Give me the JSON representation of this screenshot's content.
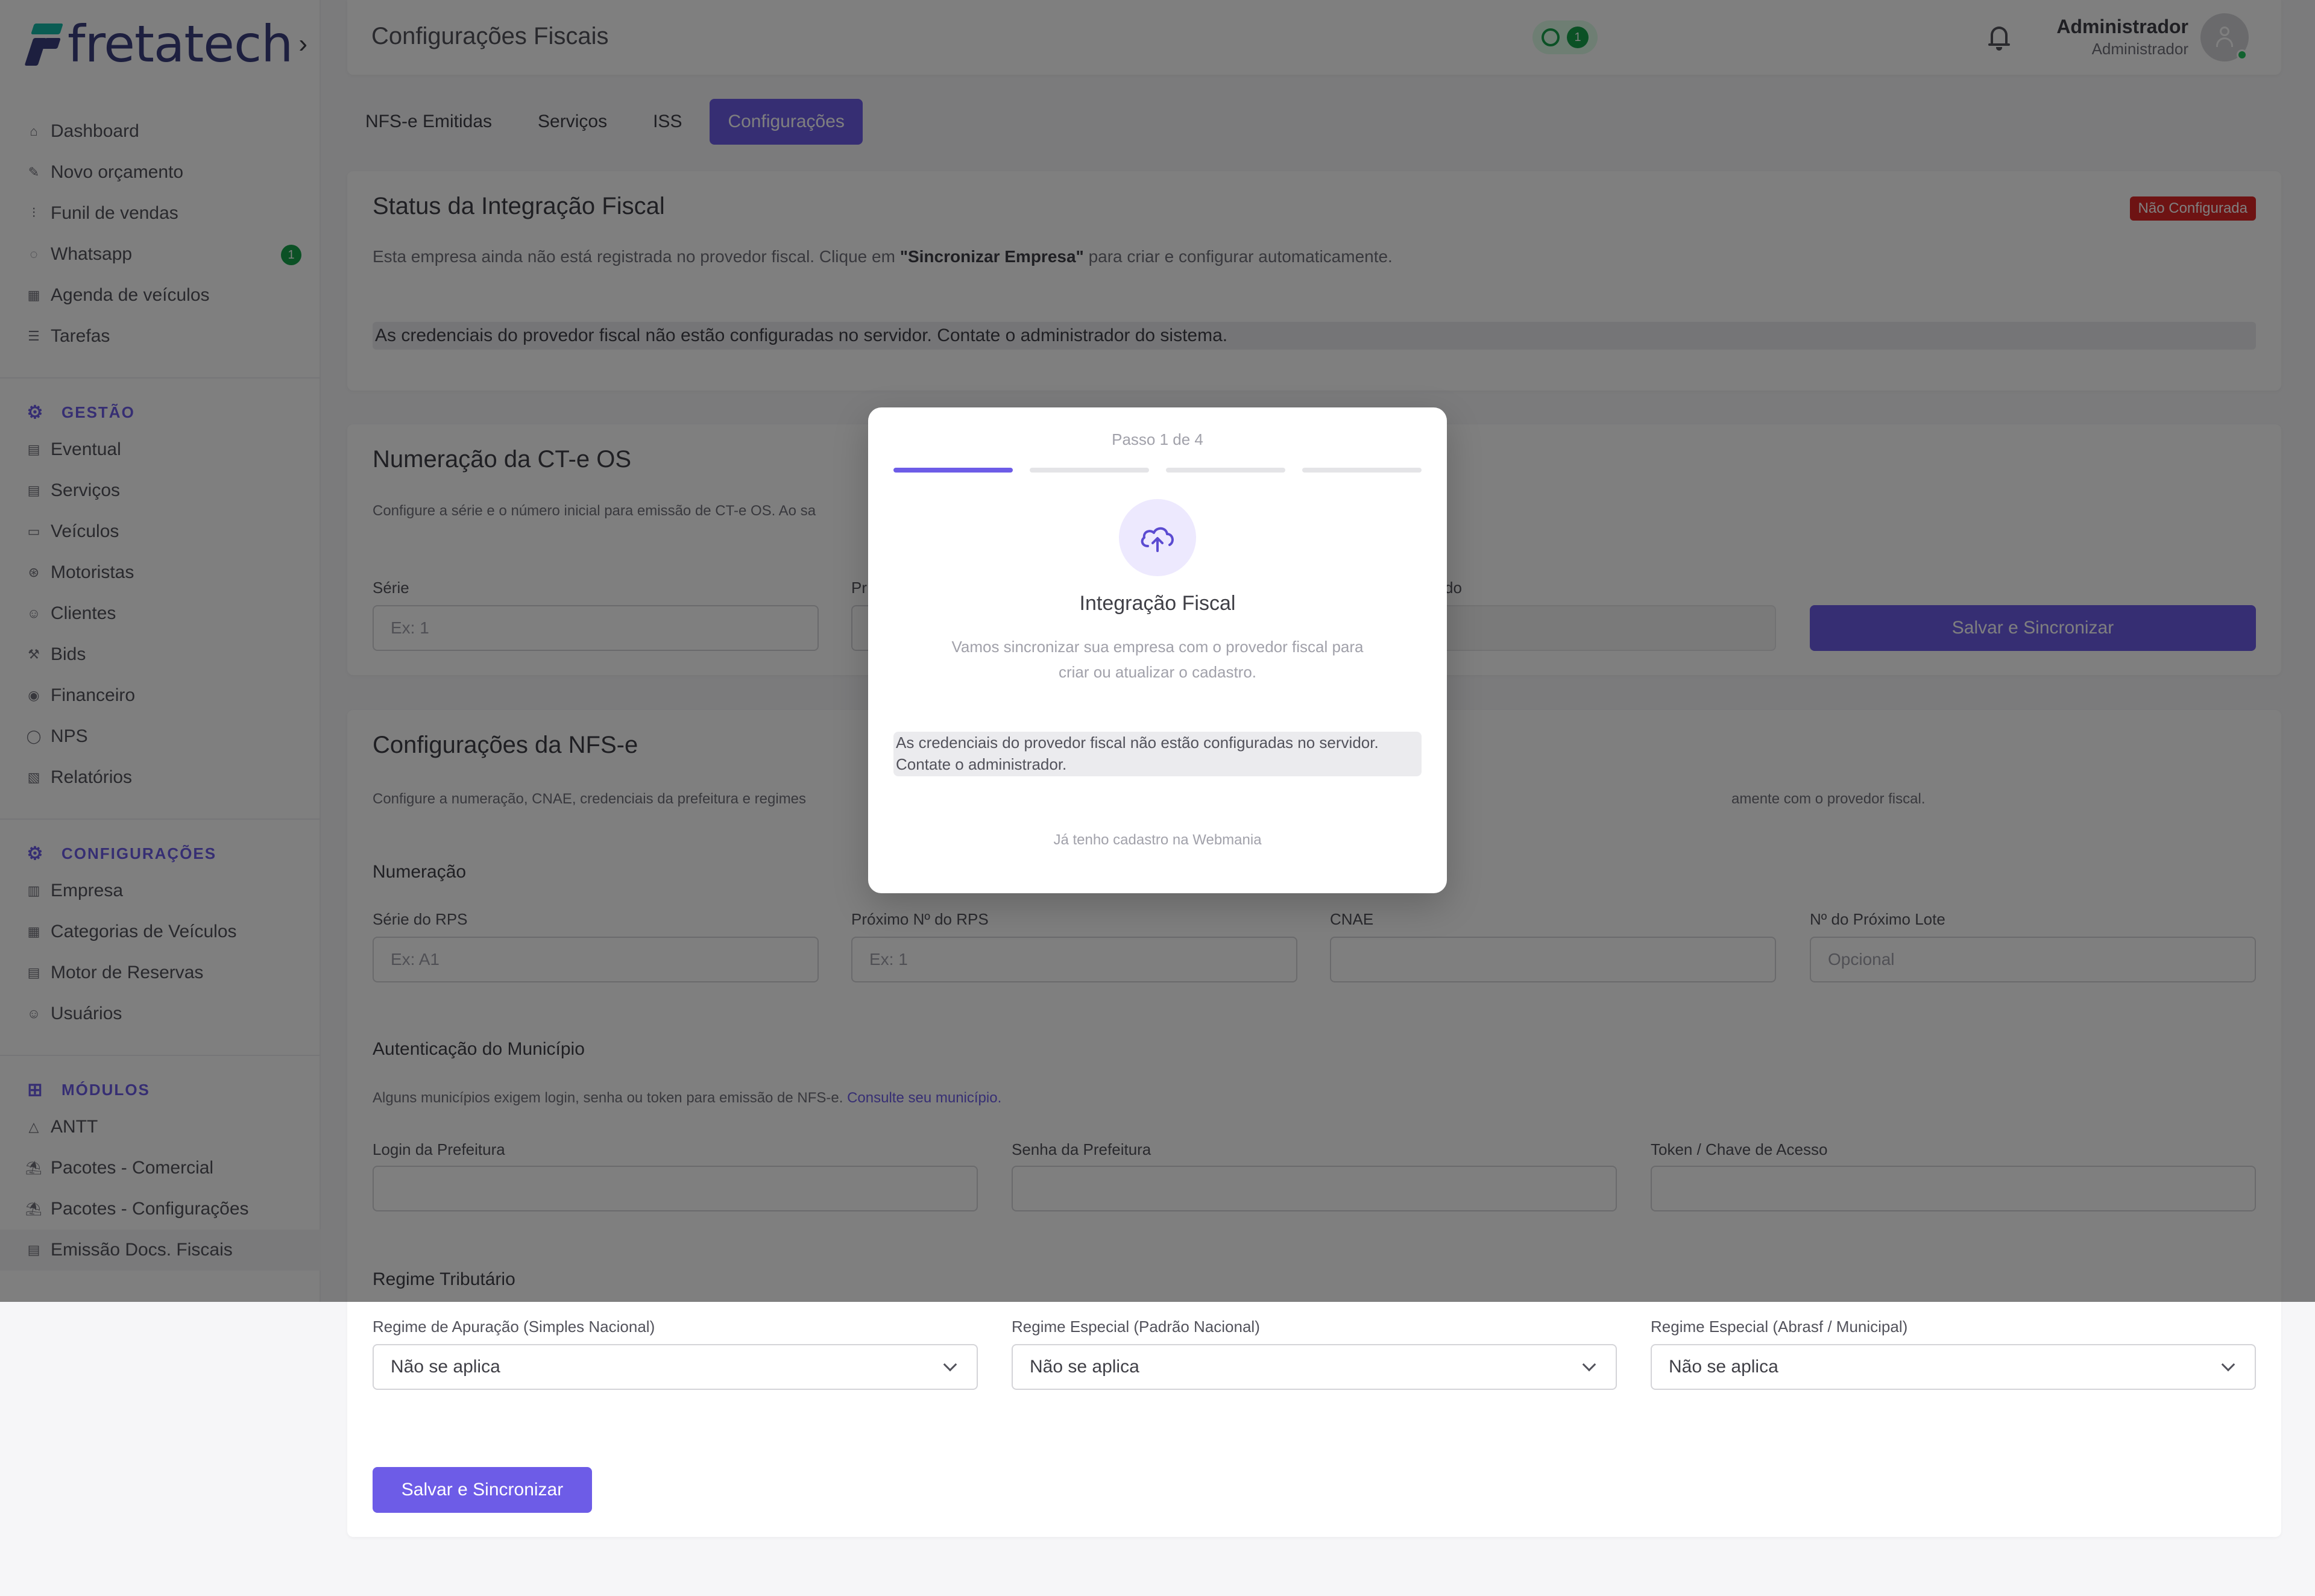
{
  "app": {
    "logo_text": "fretatech",
    "logo_chevron": "›"
  },
  "sidebar": {
    "main_items": [
      {
        "label": "Dashboard",
        "icon": "home-icon"
      },
      {
        "label": "Novo orçamento",
        "icon": "edit-icon"
      },
      {
        "label": "Funil de vendas",
        "icon": "funnel-icon"
      },
      {
        "label": "Whatsapp",
        "icon": "whatsapp-icon",
        "badge": "1"
      },
      {
        "label": "Agenda de veículos",
        "icon": "calendar-icon"
      },
      {
        "label": "Tarefas",
        "icon": "list-icon"
      }
    ],
    "gestao": {
      "title": "GESTÃO",
      "items": [
        "Eventual",
        "Serviços",
        "Veículos",
        "Motoristas",
        "Clientes",
        "Bids",
        "Financeiro",
        "NPS",
        "Relatórios"
      ]
    },
    "configuracoes": {
      "title": "CONFIGURAÇÕES",
      "items": [
        "Empresa",
        "Categorias de Veículos",
        "Motor de Reservas",
        "Usuários"
      ]
    },
    "modulos": {
      "title": "MÓDULOS",
      "items": [
        "ANTT",
        "Pacotes - Comercial",
        "Pacotes - Configurações",
        "Emissão Docs. Fiscais"
      ]
    }
  },
  "header": {
    "title": "Configurações Fiscais",
    "whatsapp_count": "1",
    "user_name": "Administrador",
    "user_role": "Administrador"
  },
  "tabs": [
    "NFS-e Emitidas",
    "Serviços",
    "ISS",
    "Configurações"
  ],
  "status_card": {
    "title": "Status da Integração Fiscal",
    "badge": "Não Configurada",
    "desc_prefix": "Esta empresa ainda não está registrada no provedor fiscal. Clique em ",
    "desc_bold": "\"Sincronizar Empresa\"",
    "desc_suffix": " para criar e configurar automaticamente.",
    "alert": "As credenciais do provedor fiscal não estão configuradas no servidor. Contate o administrador do sistema."
  },
  "cte_card": {
    "title": "Numeração da CT-e OS",
    "desc": "Configure a série e o número inicial para emissão de CT-e OS. Ao sa",
    "serie_label": "Série",
    "serie_placeholder": "Ex: 1",
    "second_label_partial": "Pr",
    "third_label_partial": "do",
    "button": "Salvar e Sincronizar"
  },
  "nfse_card": {
    "title": "Configurações da NFS-e",
    "desc_left": "Configure a numeração, CNAE, credenciais da prefeitura e regimes",
    "desc_right": "amente com o provedor fiscal.",
    "numeracao_label": "Numeração",
    "serie_rps_label": "Série do RPS",
    "serie_rps_placeholder": "Ex: A1",
    "proximo_rps_label": "Próximo Nº do RPS",
    "proximo_rps_placeholder": "Ex: 1",
    "cnae_label": "CNAE",
    "lote_label": "Nº do Próximo Lote",
    "lote_placeholder": "Opcional",
    "auth_label": "Autenticação do Município",
    "auth_desc": "Alguns municípios exigem login, senha ou token para emissão de NFS-e. ",
    "auth_link": "Consulte seu município.",
    "login_label": "Login da Prefeitura",
    "senha_label": "Senha da Prefeitura",
    "token_label": "Token / Chave de Acesso",
    "regime_label": "Regime Tributário",
    "regime_apuracao_label": "Regime de Apuração (Simples Nacional)",
    "regime_apuracao_value": "Não se aplica",
    "regime_especial_label": "Regime Especial (Padrão Nacional)",
    "regime_especial_value": "Não se aplica",
    "regime_municipal_label": "Regime Especial (Abrasf / Municipal)",
    "regime_municipal_value": "Não se aplica",
    "button": "Salvar e Sincronizar"
  },
  "modal": {
    "step": "Passo 1 de 4",
    "steps_total": 4,
    "steps_done": 1,
    "icon": "cloud-upload-icon",
    "title": "Integração Fiscal",
    "desc": "Vamos sincronizar sua empresa com o provedor fiscal para criar ou atualizar o cadastro.",
    "alert": "As credenciais do provedor fiscal não estão configuradas no servidor. Contate o administrador.",
    "link": "Já tenho cadastro na Webmania"
  },
  "colors": {
    "accent": "#6d5ce7",
    "danger": "#dc2626",
    "success": "#16a34a",
    "brand": "#3b3f7e"
  }
}
